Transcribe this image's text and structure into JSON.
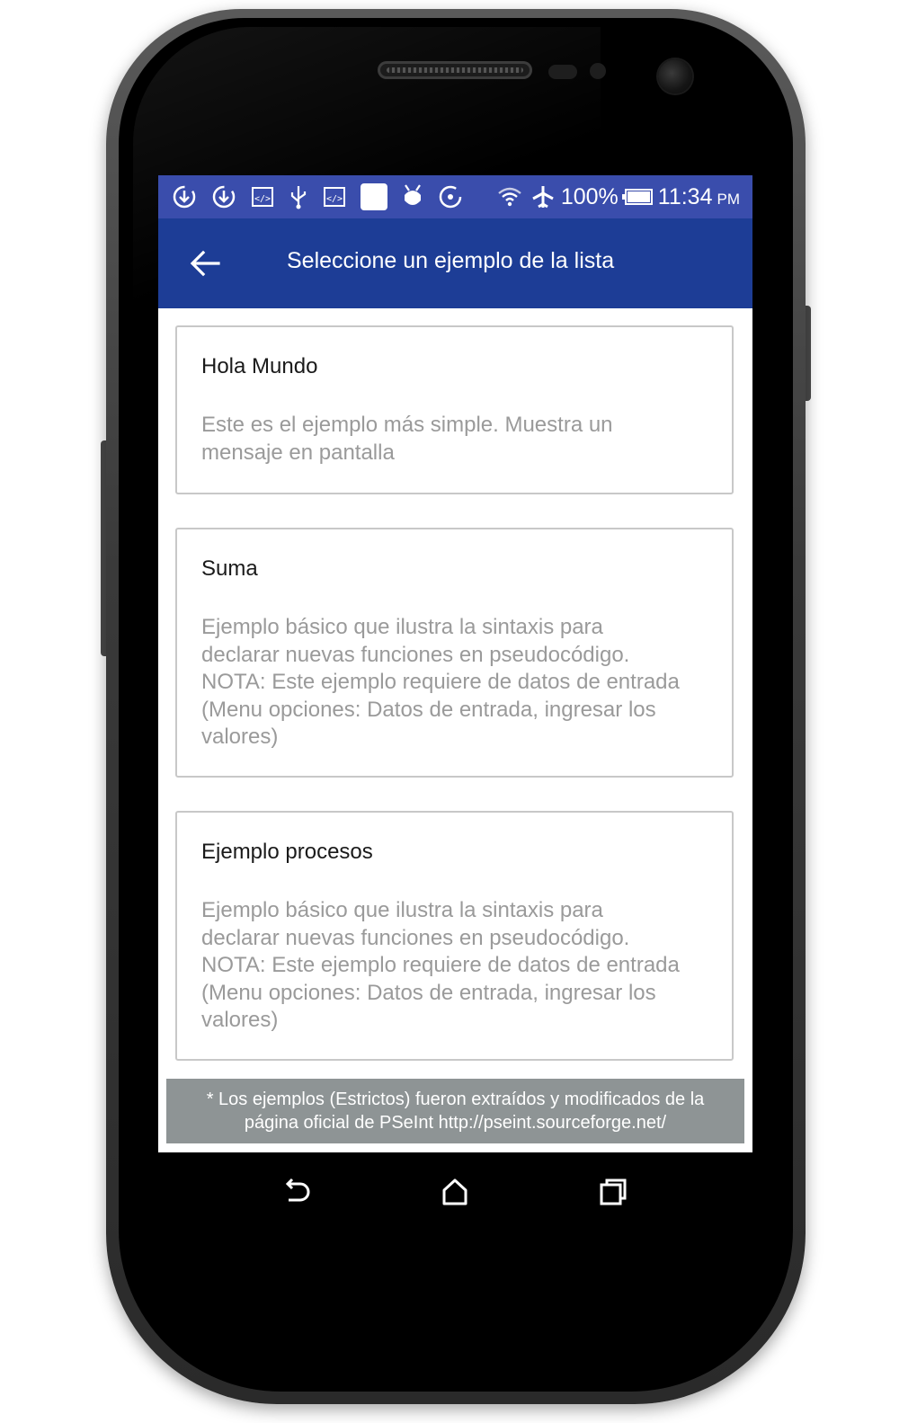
{
  "status_bar": {
    "icons": [
      "sync-icon",
      "sync-icon",
      "code-icon",
      "usb-icon",
      "code-icon",
      "notification-square-icon",
      "android-debug-icon",
      "loading-icon",
      "wifi-icon",
      "airplane-mode-icon",
      "battery-icon"
    ],
    "battery_percent": "100%",
    "time": "11:34",
    "ampm": "PM"
  },
  "app_bar": {
    "back_icon": "arrow-left-icon",
    "title": "Seleccione un ejemplo de la lista",
    "color": "#1d3d96"
  },
  "examples": [
    {
      "title": "Hola Mundo",
      "description_lines": [
        "Este es el ejemplo más simple. Muestra un",
        "mensaje en pantalla"
      ]
    },
    {
      "title": "Suma",
      "description_lines": [
        "Ejemplo básico que ilustra la sintaxis para",
        "declarar nuevas funciones en pseudocódigo.",
        "NOTA: Este ejemplo requiere de datos de entrada",
        "(Menu opciones: Datos de entrada, ingresar los",
        "valores)"
      ]
    },
    {
      "title": "Ejemplo procesos",
      "description_lines": [
        "Ejemplo básico que ilustra la sintaxis para",
        "declarar nuevas funciones en pseudocódigo.",
        "NOTA: Este ejemplo requiere de datos de entrada",
        "(Menu opciones: Datos de entrada, ingresar los",
        "valores)"
      ]
    }
  ],
  "footer": {
    "line1": "* Los ejemplos (Estrictos) fueron extraídos y modificados de la",
    "line2": "página oficial de PSeInt http://pseint.sourceforge.net/"
  },
  "nav_bar": {
    "icons": [
      "back-nav-icon",
      "home-icon",
      "recents-icon"
    ]
  }
}
